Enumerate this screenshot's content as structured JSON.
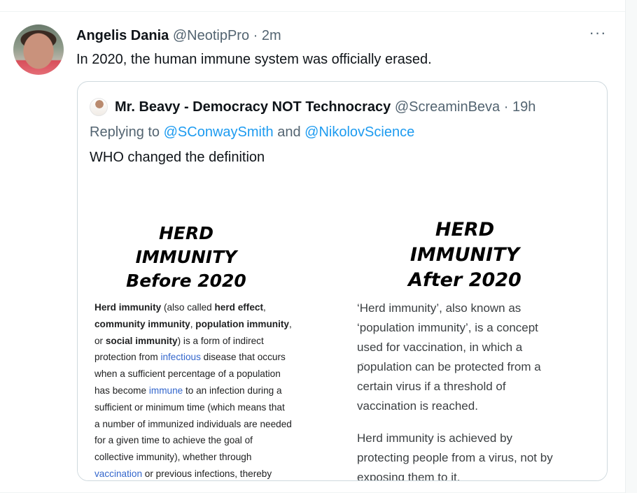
{
  "tweet": {
    "display_name": "Angelis Dania",
    "handle": "@NeotipPro",
    "separator": "·",
    "time": "2m",
    "text": "In 2020, the human immune system was officially erased.",
    "more_icon": "···"
  },
  "quote": {
    "display_name": "Mr. Beavy - Democracy NOT Technocracy",
    "handle": "@ScreaminBeva",
    "separator": "·",
    "time": "19h",
    "replying_prefix": "Replying to",
    "reply_to_1": "@SConwaySmith",
    "reply_and": "and",
    "reply_to_2": "@NikolovScience",
    "text": "WHO changed the definition",
    "image": {
      "left_title": [
        "HERD",
        "IMMUNITY",
        "Before 2020"
      ],
      "right_title": [
        "HERD",
        "IMMUNITY",
        "After 2020"
      ],
      "left_body": {
        "t1": "Herd immunity",
        "t2": " (also called ",
        "t3": "herd effect",
        "t4": ",",
        "t5": "community immunity",
        "t6": ", ",
        "t7": "population immunity",
        "t8": ",",
        "t9": "or ",
        "t10": "social immunity",
        "t11": ") is a form of indirect",
        "t12": "protection from ",
        "t13": "infectious",
        "t14": " disease that occurs",
        "t15": "when a sufficient percentage of a population",
        "t16": "has become ",
        "t17": "immune",
        "t18": " to an infection during a",
        "t19": "sufficient or minimum time (which means that",
        "t20": "a number of immunized individuals are needed",
        "t21": "for a given time to achieve the goal of",
        "t22": "collective immunity), whether through",
        "t23": "vaccination",
        "t24": " or previous infections, thereby"
      },
      "right_body": {
        "p1": [
          "‘Herd immunity’, also known as",
          "‘population immunity’, is a concept",
          "used for vaccination, in which a",
          "population can be protected from a",
          "certain virus if a threshold of",
          "vaccination is reached."
        ],
        "p2": [
          "Herd immunity is achieved by",
          "protecting people from a virus, not by",
          "exposing them to it."
        ]
      }
    }
  }
}
